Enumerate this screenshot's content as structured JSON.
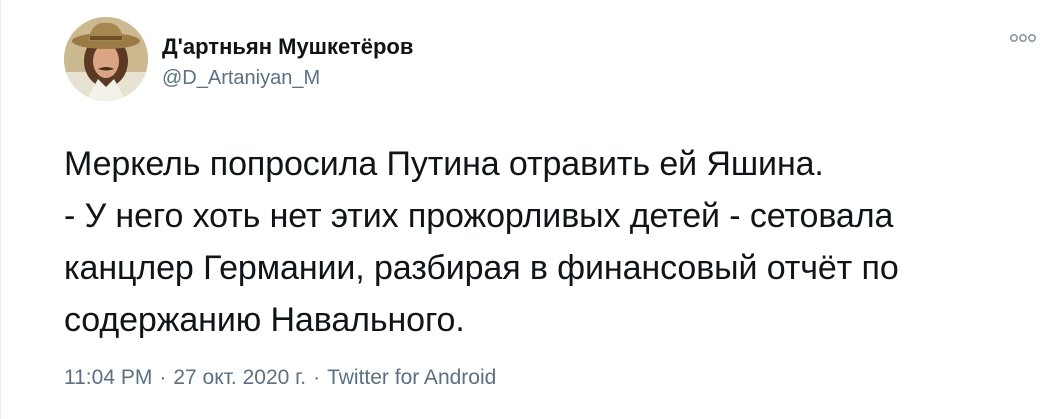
{
  "author": {
    "display_name": "Д'артньян Мушкетёров",
    "handle": "@D_Artaniyan_M"
  },
  "tweet": {
    "text": "Меркель попросила Путина отравить ей Яшина.\n- У него хоть нет этих прожорливых детей - сетовала\nканцлер Германии, разбирая в финансовый отчёт по\nсодержанию Навального."
  },
  "meta": {
    "time": "11:04 PM",
    "separator": "·",
    "date": "27 окт. 2020 г.",
    "source": "Twitter for Android"
  },
  "icons": {
    "more": "more-dots-icon",
    "avatar": "profile-avatar"
  },
  "colors": {
    "text": "#0f1419",
    "secondary": "#5b7083"
  }
}
